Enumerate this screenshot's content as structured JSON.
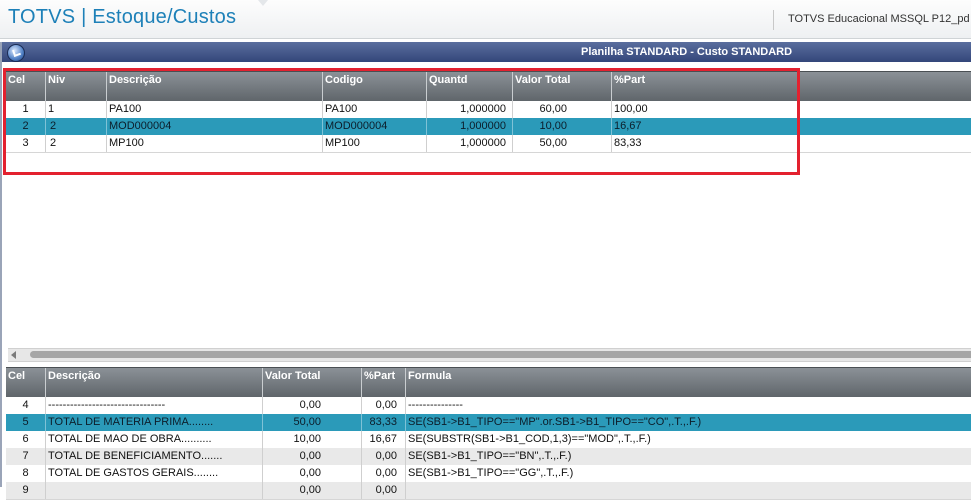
{
  "app": {
    "title": "TOTVS | Estoque/Custos",
    "environment": "TOTVS Educacional MSSQL P12_pd"
  },
  "window": {
    "title": "Planilha STANDARD - Custo STANDARD"
  },
  "top_grid": {
    "headers": [
      "Cel",
      "Niv",
      "Descrição",
      "Codigo",
      "Quantd",
      "Valor Total",
      "%Part"
    ],
    "rows": [
      [
        "1",
        "1",
        "PA100",
        "PA100",
        "1,000000",
        "60,00",
        "100,00"
      ],
      [
        "2",
        "2",
        "MOD000004",
        "MOD000004",
        "1,000000",
        "10,00",
        "16,67"
      ],
      [
        "3",
        "2",
        "MP100",
        "MP100",
        "1,000000",
        "50,00",
        "83,33"
      ]
    ],
    "selected_row": 1
  },
  "bottom_grid": {
    "headers": [
      "Cel",
      "Descrição",
      "Valor Total",
      "%Part",
      "Formula"
    ],
    "rows": [
      [
        "4",
        "--------------------------------",
        "0,00",
        "0,00",
        "---------------"
      ],
      [
        "5",
        "TOTAL DE MATERIA PRIMA........",
        "50,00",
        "83,33",
        "SE(SB1->B1_TIPO==\"MP\".or.SB1->B1_TIPO==\"CO\",.T.,.F.)"
      ],
      [
        "6",
        "TOTAL DE MAO DE OBRA..........",
        "10,00",
        "16,67",
        "SE(SUBSTR(SB1->B1_COD,1,3)==\"MOD\",.T.,.F.)"
      ],
      [
        "7",
        "TOTAL DE BENEFICIAMENTO.......",
        "0,00",
        "0,00",
        "SE(SB1->B1_TIPO==\"BN\",.T.,.F.)"
      ],
      [
        "8",
        "TOTAL DE GASTOS GERAIS........",
        "0,00",
        "0,00",
        "SE(SB1->B1_TIPO==\"GG\",.T.,.F.)"
      ],
      [
        "9",
        "",
        "0,00",
        "0,00",
        ""
      ]
    ],
    "selected_row": 1
  },
  "colors": {
    "accent": "#1d80b8",
    "selection": "#2b9ab9",
    "highlight_border": "#e3212f"
  }
}
